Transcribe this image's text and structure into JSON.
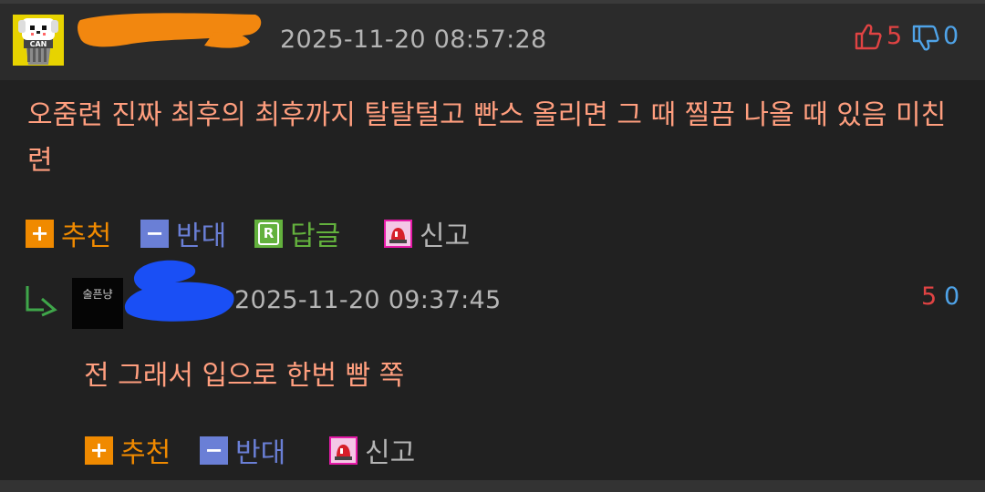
{
  "comment": {
    "timestamp": "2025-11-20 08:57:28",
    "upvotes": "5",
    "downvotes": "0",
    "text_line1": "오줌련 진짜 최후의 최후까지 탈탈털고 빤스 올리면 그 때 찔끔 나올 때 있음 미친",
    "text_line2": "련",
    "actions": {
      "recommend": "추천",
      "oppose": "반대",
      "reply": "답글",
      "report": "신고"
    }
  },
  "reply": {
    "avatar_text": "술픈냥",
    "timestamp": "2025-11-20 09:37:45",
    "upvotes": "5",
    "downvotes": "0",
    "text": "전 그래서 입으로 한번 빰 쪽",
    "actions": {
      "recommend": "추천",
      "oppose": "반대",
      "report": "신고"
    }
  },
  "colors": {
    "comment_text": "#ff9e7e",
    "recommend": "#f08a00",
    "oppose": "#6a7fd6",
    "reply": "#63b13d",
    "report": "#e61aa8",
    "upvote": "#e04343",
    "downvote": "#4fa3e8"
  },
  "icons": [
    "avatar-dog-can-icon",
    "thumbs-up-icon",
    "thumbs-down-icon",
    "plus-icon",
    "minus-icon",
    "reply-r-icon",
    "siren-icon",
    "reply-arrow-icon"
  ]
}
